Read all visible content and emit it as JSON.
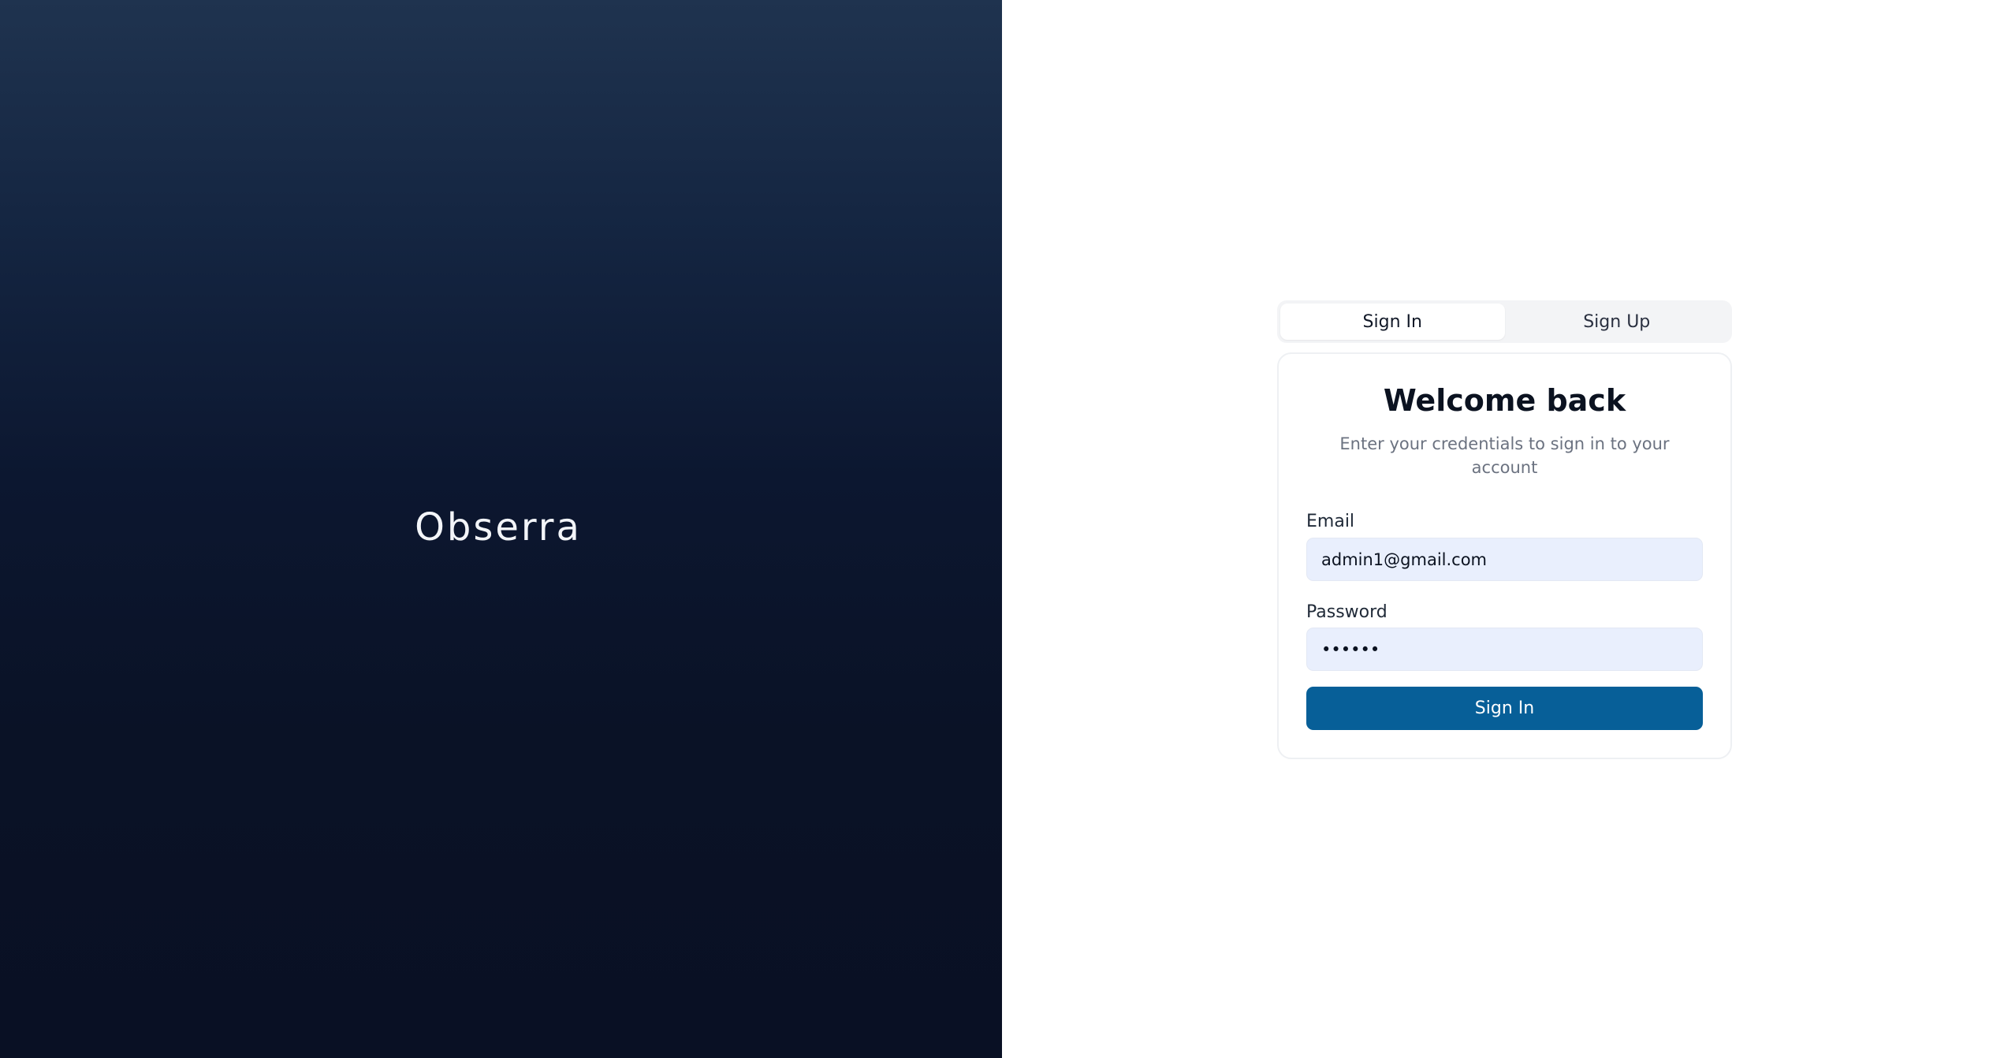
{
  "brand": {
    "name": "Obserra"
  },
  "tabs": [
    {
      "label": "Sign In",
      "active": true
    },
    {
      "label": "Sign Up",
      "active": false
    }
  ],
  "card": {
    "title": "Welcome back",
    "subtitle": "Enter your credentials to sign in to your account"
  },
  "form": {
    "email": {
      "label": "Email",
      "value": "admin1@gmail.com"
    },
    "password": {
      "label": "Password",
      "value": "••••••"
    },
    "submit_label": "Sign In"
  },
  "colors": {
    "primary": "#075f98",
    "input_bg": "#e9effd",
    "brand_bg_top": "#1f334f",
    "brand_bg_bottom": "#091024"
  }
}
